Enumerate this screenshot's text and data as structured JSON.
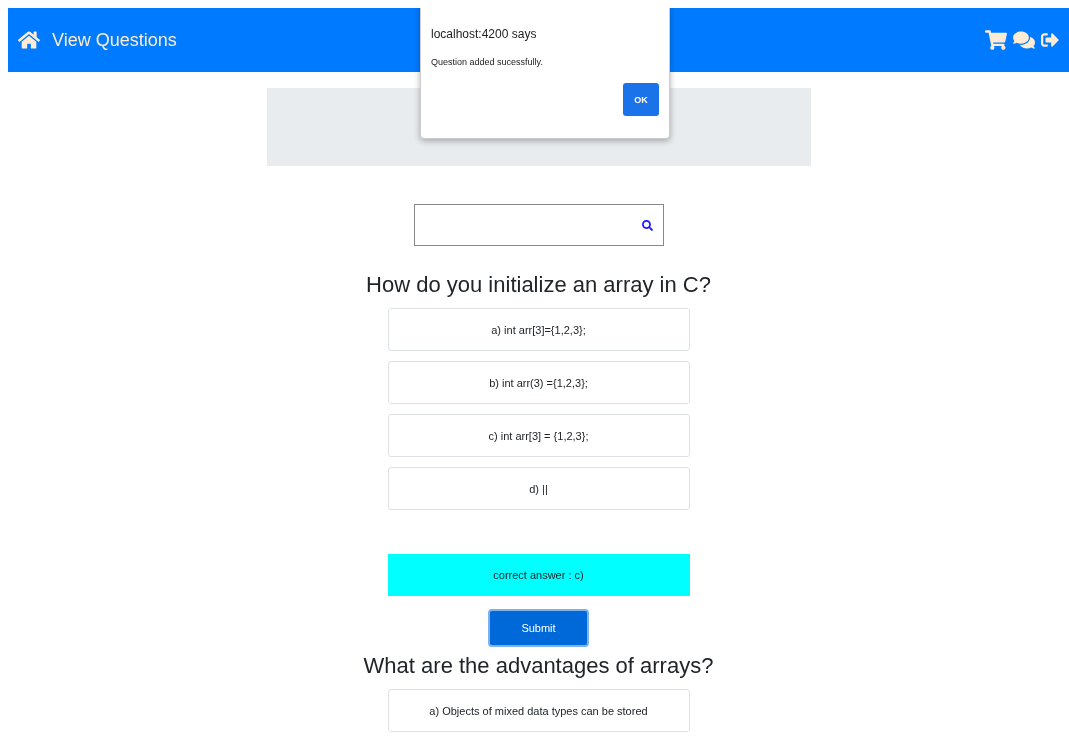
{
  "navbar": {
    "title": "View Questions"
  },
  "dialog": {
    "title": "localhost:4200 says",
    "message": "Question added sucessfully.",
    "button": "OK"
  },
  "questions": [
    {
      "question": "How do you initialize an array in C?",
      "options": [
        "a) int arr[3]={1,2,3};",
        "b) int arr(3) ={1,2,3};",
        "c) int arr[3] = {1,2,3};",
        "d) ||"
      ],
      "answer": "correct answer : c)",
      "submit": "Submit"
    },
    {
      "question": "What are the advantages of arrays?",
      "options": [
        "a) Objects of mixed data types can be stored"
      ]
    }
  ]
}
